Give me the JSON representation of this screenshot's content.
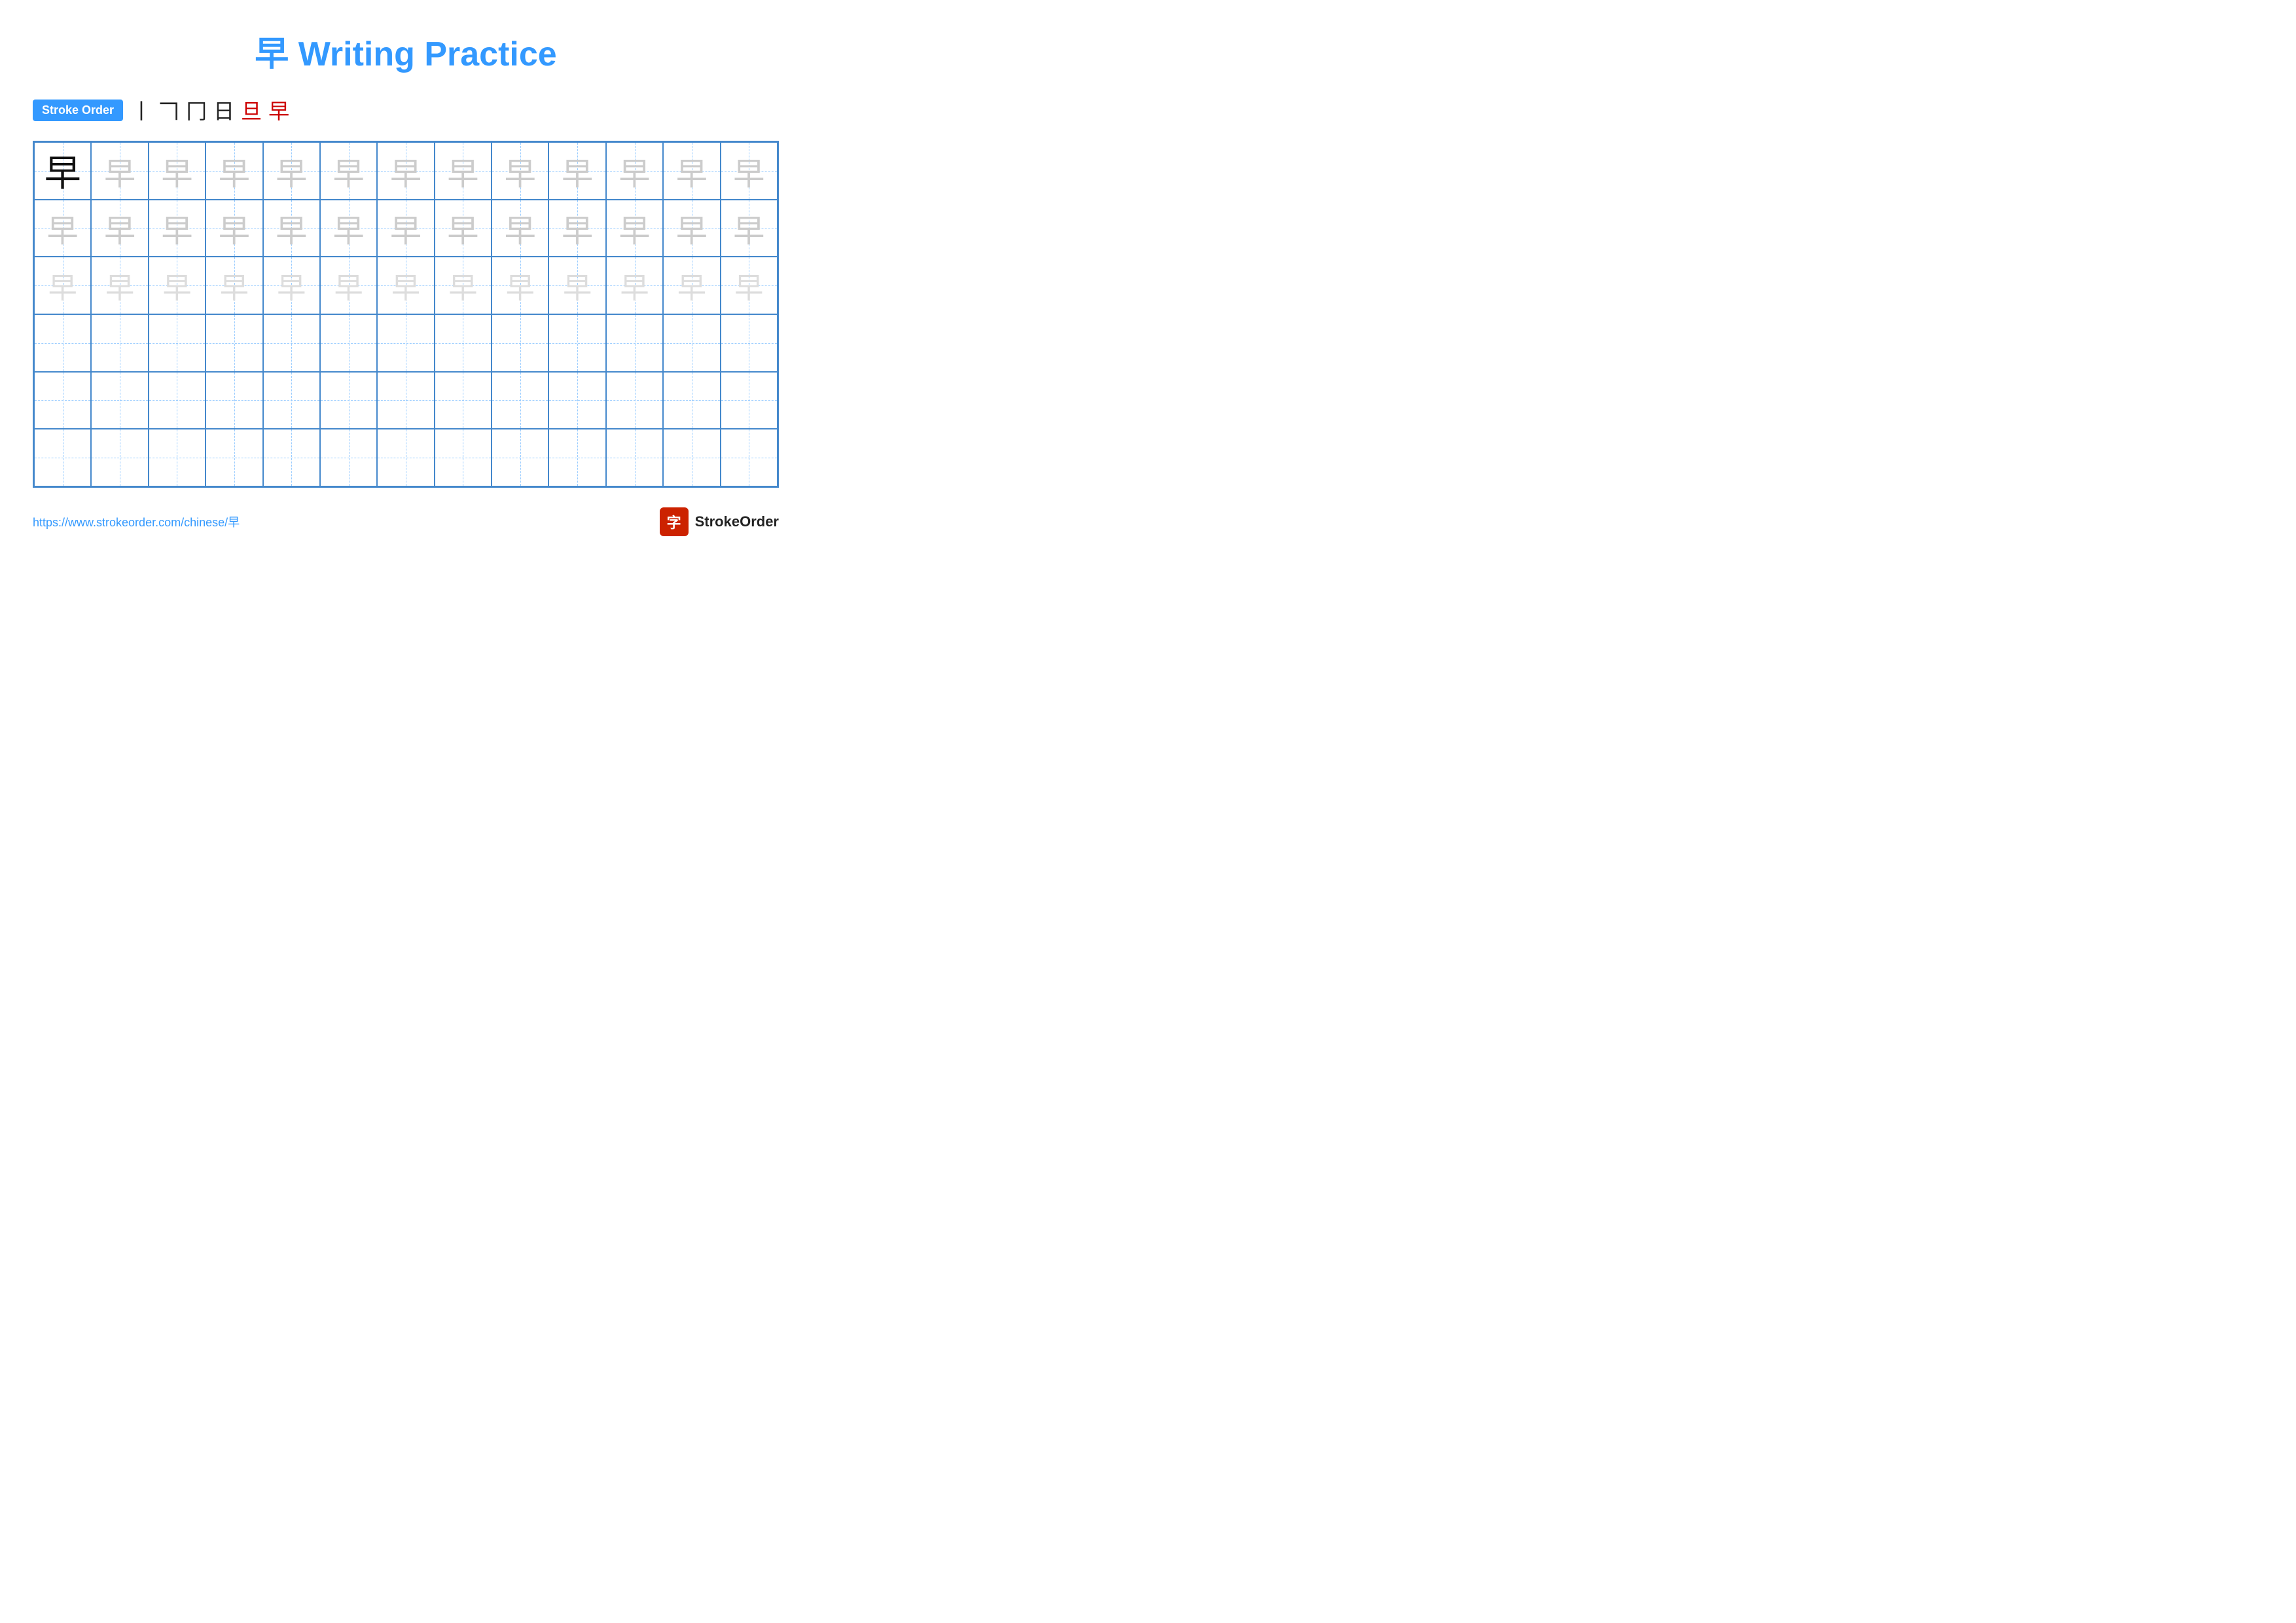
{
  "title": {
    "char": "早",
    "text": " Writing Practice"
  },
  "stroke_order": {
    "badge_label": "Stroke Order",
    "strokes": [
      "丨",
      "𠃍",
      "冂",
      "日",
      "旦",
      "早"
    ]
  },
  "grid": {
    "cols": 13,
    "rows": 6,
    "reference_char": "早",
    "row1_style": "dark_then_light",
    "row2_style": "light",
    "row3_style": "lighter",
    "rows4to6_style": "empty"
  },
  "footer": {
    "url": "https://www.strokeorder.com/chinese/早",
    "brand_char": "字",
    "brand_name": "StrokeOrder"
  }
}
